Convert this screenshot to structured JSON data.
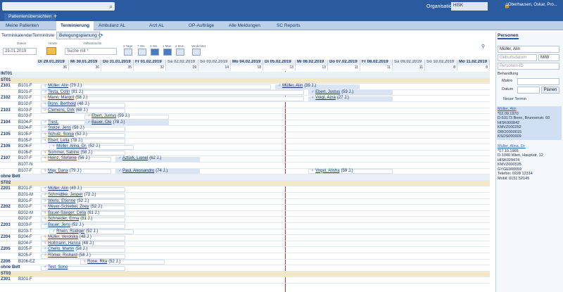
{
  "header": {
    "search_placeholder": "",
    "org_label": "Organisation",
    "org_value": "HISK",
    "user": "Oberhausen, Oskar, Pro...",
    "tab": "Patientenübersichten"
  },
  "nav": [
    "Meine Patienten",
    "Terminierung",
    "Ambulanz AL",
    "Arzt AL",
    "OP-Aufträge",
    "Alle Meldungen",
    "SC Reports"
  ],
  "subtabs": [
    "Terminkalender",
    "Terminliste",
    "Belegungsplanung"
  ],
  "toolbar": {
    "datum_label": "Datum",
    "datum": "29.01.2019",
    "heute": "Heute",
    "volltext_label": "Volltextsuche",
    "volltext_placeholder": "Suche mit *",
    "tage": [
      "2 Tage",
      "7 Wo.",
      "3 Wo.",
      "1 Mon",
      "2 Mon",
      "Verdichtet"
    ]
  },
  "days": [
    {
      "label": "Di 29.01.2019",
      "count": "36",
      "we": false
    },
    {
      "label": "Mi 30.01.2019",
      "count": "36",
      "we": false
    },
    {
      "label": "Do 31.01.2019",
      "count": "35",
      "we": false
    },
    {
      "label": "Fr 01.02.2019",
      "count": "32",
      "we": false
    },
    {
      "label": "Sa 02.02.2019",
      "count": "19",
      "we": true
    },
    {
      "label": "So 03.02.2019",
      "count": "14",
      "we": true
    },
    {
      "label": "Mo 04.02.2019",
      "count": "18",
      "we": false
    },
    {
      "label": "Di 05.02.2019",
      "count": "13",
      "we": false
    },
    {
      "label": "Mi 06.02.2019",
      "count": "13",
      "we": false
    },
    {
      "label": "Do 07.02.2019",
      "count": "11",
      "we": false
    },
    {
      "label": "Fr 08.02.2019",
      "count": "11",
      "we": false
    },
    {
      "label": "Sa 09.02.2019",
      "count": "11",
      "we": true
    },
    {
      "label": "So 10.02.2019",
      "count": "8",
      "we": true
    },
    {
      "label": "Mo 11.02.2019",
      "count": "8",
      "we": false
    }
  ],
  "rows": [
    {
      "a": "INT01",
      "b": "",
      "t": "sep"
    },
    {
      "a": "ST01",
      "b": "",
      "t": "st"
    },
    {
      "a": "Z101",
      "b": "B101-F",
      "p": [
        [
          "Müller, Alin",
          "(79 J.)",
          "m",
          62
        ],
        [
          "Müller, Alin",
          "(39 J.)",
          "m",
          395
        ]
      ]
    },
    {
      "a": "",
      "b": "B101-F",
      "p": [
        [
          "Testa, Colin",
          "(81 J.)",
          "m",
          62
        ],
        [
          "Ebert, Justus",
          "(59 J.)",
          "m",
          442
        ]
      ]
    },
    {
      "a": "Z102",
      "b": "B102-F",
      "p": [
        [
          "Mann, Margot",
          "(58 J.)",
          "f",
          62
        ],
        [
          "Voigt, Azra",
          "(27 J.)",
          "f",
          442
        ]
      ]
    },
    {
      "a": "",
      "b": "B102-F",
      "p": [
        [
          "Bonn, Berthold",
          "(48 J.)",
          "f",
          62
        ]
      ]
    },
    {
      "a": "Z103",
      "b": "B103-F",
      "p": [
        [
          "Clemens, Dirk",
          "(68 J.)",
          "m",
          62
        ]
      ]
    },
    {
      "a": "",
      "b": "B103-F",
      "p": [
        [
          "Ebert, Justus",
          "(59 J.)",
          "m",
          124
        ]
      ]
    },
    {
      "a": "Z104",
      "b": "B104-F",
      "p": [
        [
          "Trest,",
          "",
          "m",
          62
        ],
        [
          "Bauer, Ole",
          "(78 J.)",
          "m",
          124
        ]
      ]
    },
    {
      "a": "",
      "b": "B104-F",
      "p": [
        [
          "Stolze, Jens",
          "(58 J.)",
          "m",
          62
        ]
      ]
    },
    {
      "a": "Z105",
      "b": "B105-F",
      "p": [
        [
          "Schulz, Sonja",
          "(52 J.)",
          "f",
          62
        ]
      ]
    },
    {
      "a": "",
      "b": "B105-F",
      "p": [
        [
          "Ebert, Leila",
          "(78 J.)",
          "f",
          62
        ]
      ]
    },
    {
      "a": "Z106",
      "b": "B106-F",
      "p": [
        [
          "Müller, Alina, Dr.",
          "(52 J.)",
          "f",
          74
        ]
      ]
    },
    {
      "a": "",
      "b": "B106-F",
      "p": [
        [
          "Sommer, Sabine",
          "(58 J.)",
          "f",
          62
        ]
      ]
    },
    {
      "a": "Z107",
      "b": "B107-F",
      "p": [
        [
          "Heinz, Stefanie",
          "(56 J.)",
          "f",
          62
        ],
        [
          "Aztürk, Lionel",
          "(62 J.)",
          "m",
          168
        ]
      ]
    },
    {
      "a": "",
      "b": "B107-N",
      "p": []
    },
    {
      "a": "",
      "b": "B107-F",
      "p": [
        [
          "May, Dana",
          "(79 J.)",
          "f",
          62
        ],
        [
          "Paul, Alessandro",
          "(74 J.)",
          "m",
          168
        ],
        [
          "Vogel, Alisha",
          "(59 J.)",
          "f",
          442
        ]
      ]
    },
    {
      "a": "ohne Bett",
      "b": "",
      "t": "sep"
    },
    {
      "a": "ST02",
      "b": "",
      "t": "st"
    },
    {
      "a": "Z201",
      "b": "B201-F",
      "p": [
        [
          "Müller, Alin",
          "(49 J.)",
          "m",
          62
        ]
      ]
    },
    {
      "a": "",
      "b": "B201-M",
      "p": [
        [
          "Schmidtke, Jesper",
          "(72 J.)",
          "m",
          62
        ]
      ]
    },
    {
      "a": "",
      "b": "B201-F",
      "p": [
        [
          "Werle, Etienne",
          "(52 J.)",
          "m",
          62
        ]
      ]
    },
    {
      "a": "Z202",
      "b": "B202-F",
      "p": [
        [
          "Meyer-Schiebel, Zoey",
          "(52 J.)",
          "f",
          62
        ]
      ]
    },
    {
      "a": "",
      "b": "B202-M",
      "p": [
        [
          "Bauer-Saeger, Celia",
          "(61 J.)",
          "f",
          62
        ]
      ]
    },
    {
      "a": "",
      "b": "B202-F",
      "p": [
        [
          "Schneider, Enna",
          "(81 J.)",
          "f",
          62
        ]
      ]
    },
    {
      "a": "Z203",
      "b": "B203-F",
      "p": [
        [
          "Bauer, Jens",
          "(52 J.)",
          "m",
          62
        ]
      ]
    },
    {
      "a": "",
      "b": "B203-T",
      "p": [
        [
          "Rhein, Rüdiger",
          "(52 J.)",
          "m",
          74
        ]
      ]
    },
    {
      "a": "Z204",
      "b": "B204-F",
      "p": [
        [
          "Müller, Veronika",
          "(48 J.)",
          "f",
          62
        ]
      ]
    },
    {
      "a": "",
      "b": "B204-F",
      "p": [
        [
          "Hollmann, Hanna",
          "(48 J.)",
          "f",
          62
        ]
      ]
    },
    {
      "a": "Z205",
      "b": "B205-F",
      "p": [
        [
          "Chello, Martin",
          "(58 J.)",
          "m",
          62
        ]
      ]
    },
    {
      "a": "",
      "b": "B205-F",
      "p": [
        [
          "Römer, Richard",
          "(58 J.)",
          "m",
          62
        ]
      ]
    },
    {
      "a": "Z206",
      "b": "B206-EZ",
      "p": [
        [
          "Rose, Rita",
          "(52 J.)",
          "f",
          118
        ]
      ]
    },
    {
      "a": "ohne Bett",
      "b": "",
      "p": [
        [
          "Test, Sono",
          "",
          "m",
          62
        ]
      ]
    },
    {
      "a": "ST03",
      "b": "",
      "t": "st"
    },
    {
      "a": "Z301",
      "b": "B301-F",
      "p": []
    }
  ],
  "sidebar": {
    "tabs": [
      "Personen"
    ],
    "name": "Müller, Alin",
    "geburt_placeholder": "Geburtsdatum",
    "mw": "M/W",
    "nr_placeholder": "Personen-ID",
    "behandlung": "Behandlung",
    "makro": "Makro",
    "datum": "Datum",
    "planen": "Planen",
    "neuer": "Neuer Termin",
    "cards": [
      {
        "name": "Müller, Alin",
        "lines": [
          "*02.09.1970",
          "D-53173 Bonn, Brunnenstr. 60",
          "HISK000842",
          "KMVZ000252",
          "ORO0000015",
          "KSOS000009"
        ],
        "sel": true
      },
      {
        "name": "Müller, Alina, Dr.",
        "lines": [
          "*17.10.1966",
          "D-1040 Wien, Hauptstr. 12",
          "HISK029474",
          "KMVZ000535",
          "GYGE000059",
          "Telefon: 0228 12314",
          "Mobil: 0151 52145"
        ],
        "sel": false
      }
    ]
  }
}
